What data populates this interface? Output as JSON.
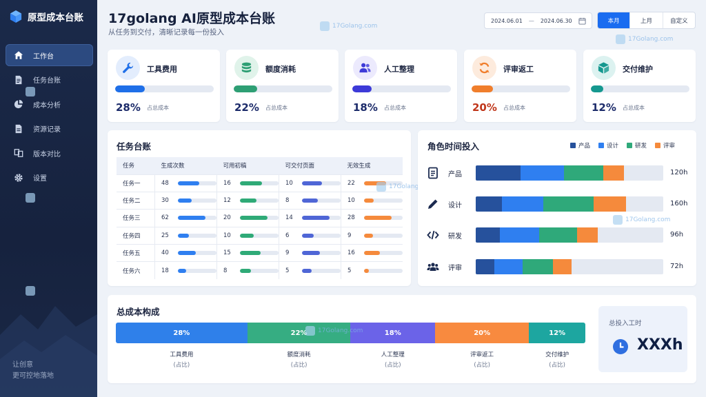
{
  "sidebar": {
    "app_name": "原型成本台账",
    "nav": [
      {
        "label": "工作台",
        "icon": "home-icon",
        "active": true
      },
      {
        "label": "任务台账",
        "icon": "document-icon"
      },
      {
        "label": "成本分析",
        "icon": "pie-chart-icon"
      },
      {
        "label": "资源记录",
        "icon": "file-list-icon"
      },
      {
        "label": "版本对比",
        "icon": "compare-icon"
      },
      {
        "label": "设置",
        "icon": "gear-icon"
      }
    ],
    "slogan_line1": "让创意",
    "slogan_line2": "更可控地落地"
  },
  "header": {
    "title": "17golang AI原型成本台账",
    "subtitle": "从任务到交付，清晰记录每一份投入",
    "date_start": "2024.06.01",
    "date_sep": "—",
    "date_end": "2024.06.30",
    "tabs": [
      {
        "label": "本月",
        "active": true
      },
      {
        "label": "上月"
      },
      {
        "label": "自定义"
      }
    ]
  },
  "watermark_text": "17Golang.com",
  "kpis": [
    {
      "name": "工具费用",
      "value": 28,
      "pct_label": "28%",
      "unit": "占总成本",
      "color": "#1f6fe8",
      "bg": "#e3edfd",
      "icon": "wrench-icon"
    },
    {
      "name": "额度消耗",
      "value": 22,
      "pct_label": "22%",
      "unit": "占总成本",
      "color": "#2e9f74",
      "bg": "#e0f3ea",
      "icon": "database-icon"
    },
    {
      "name": "人工整理",
      "value": 18,
      "pct_label": "18%",
      "unit": "占总成本",
      "color": "#3d3ad8",
      "bg": "#eceafd",
      "icon": "people-icon"
    },
    {
      "name": "评审返工",
      "value": 20,
      "pct_label": "20%",
      "unit": "占总成本",
      "color": "#f07e2c",
      "bg": "#fdebdd",
      "icon": "refresh-icon"
    },
    {
      "name": "交付维护",
      "value": 12,
      "pct_label": "12%",
      "unit": "占总成本",
      "color": "#15988f",
      "bg": "#dcf2f0",
      "icon": "cube-icon"
    }
  ],
  "ledger": {
    "title": "任务台账",
    "columns": [
      "任务",
      "生成次数",
      "可用初稿",
      "可交付页面",
      "无效生成"
    ],
    "rows": [
      {
        "name": "任务一",
        "values": [
          48,
          16,
          10,
          22
        ]
      },
      {
        "name": "任务二",
        "values": [
          30,
          12,
          8,
          10
        ]
      },
      {
        "name": "任务三",
        "values": [
          62,
          20,
          14,
          28
        ]
      },
      {
        "name": "任务四",
        "values": [
          25,
          10,
          6,
          9
        ]
      },
      {
        "name": "任务五",
        "values": [
          40,
          15,
          9,
          16
        ]
      },
      {
        "name": "任务六",
        "values": [
          18,
          8,
          5,
          5
        ]
      }
    ],
    "column_colors": [
      "#2f7ff0",
      "#2faa77",
      "#4f66d6",
      "#f58a3c"
    ],
    "column_max": [
      62,
      20,
      14,
      28
    ]
  },
  "roles": {
    "title": "角色时间投入",
    "legend": [
      {
        "label": "产品",
        "color": "#26519c"
      },
      {
        "label": "设计",
        "color": "#2f7ff0"
      },
      {
        "label": "研发",
        "color": "#2fa97a"
      },
      {
        "label": "评审",
        "color": "#f58a3c"
      }
    ],
    "rows": [
      {
        "name": "产品",
        "hours_label": "120h",
        "icon": "document-icon",
        "segments": [
          24,
          23,
          21,
          11
        ]
      },
      {
        "name": "设计",
        "hours_label": "160h",
        "icon": "pen-icon",
        "segments": [
          14,
          22,
          27,
          17
        ]
      },
      {
        "name": "研发",
        "hours_label": "96h",
        "icon": "code-icon",
        "segments": [
          13,
          21,
          20,
          11
        ]
      },
      {
        "name": "评审",
        "hours_label": "72h",
        "icon": "team-icon",
        "segments": [
          10,
          15,
          16,
          10
        ]
      }
    ]
  },
  "composition": {
    "title": "总成本构成",
    "segments": [
      {
        "label": "工具费用",
        "sub": "(占比)",
        "value": 28,
        "pct_label": "28%",
        "color": "#2f80ea"
      },
      {
        "label": "额度消耗",
        "sub": "(占比)",
        "value": 22,
        "pct_label": "22%",
        "color": "#36ad82"
      },
      {
        "label": "人工整理",
        "sub": "(占比)",
        "value": 18,
        "pct_label": "18%",
        "color": "#6b63e8"
      },
      {
        "label": "评审返工",
        "sub": "(占比)",
        "value": 20,
        "pct_label": "20%",
        "color": "#f88a3f"
      },
      {
        "label": "交付维护",
        "sub": "(占比)",
        "value": 12,
        "pct_label": "12%",
        "color": "#1da6a0"
      }
    ],
    "total_label": "总投入工时",
    "total_value": "XXXh"
  }
}
